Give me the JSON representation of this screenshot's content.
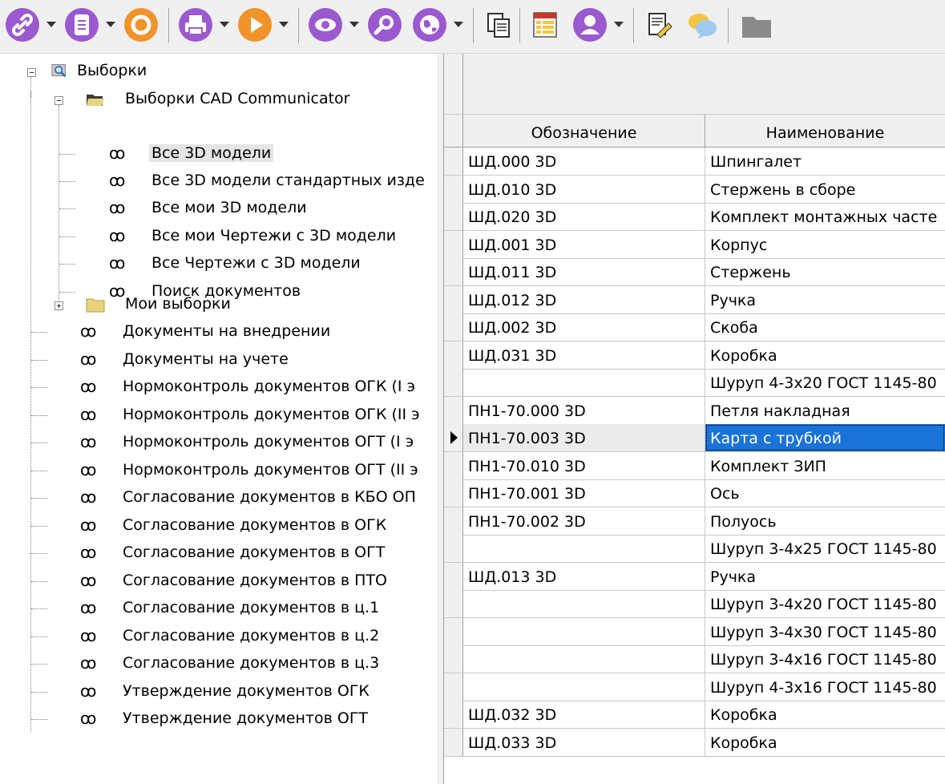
{
  "toolbar": {
    "buttons": [
      {
        "icon": "link-icon",
        "color": "#9b59d0"
      },
      {
        "icon": "document-icon",
        "color": "#9b59d0"
      },
      {
        "icon": "refresh-icon",
        "color": "#f0932b"
      },
      {
        "icon": "print-icon",
        "color": "#9b59d0"
      },
      {
        "icon": "play-icon",
        "color": "#f0932b"
      },
      {
        "icon": "eye-icon",
        "color": "#9b59d0"
      },
      {
        "icon": "search-icon",
        "color": "#9b59d0"
      },
      {
        "icon": "globe-icon",
        "color": "#9b59d0"
      },
      {
        "icon": "copy-icon",
        "color": "#555555"
      },
      {
        "icon": "report-icon",
        "color": "#c0392b"
      },
      {
        "icon": "user-icon",
        "color": "#9b59d0"
      },
      {
        "icon": "edit-document-icon",
        "color": "#555555"
      },
      {
        "icon": "comment-icon",
        "color": "#f5c542"
      },
      {
        "icon": "folder-icon",
        "color": "#888888"
      }
    ]
  },
  "tree": {
    "root": "Выборки",
    "cad_folder": "Выборки CAD Communicator",
    "cad_items": [
      "Все 3D модели",
      "Все 3D модели стандартных изде",
      "Все мои 3D модели",
      "Все мои Чертежи с 3D модели",
      "Все Чертежи с 3D модели",
      "Поиск документов"
    ],
    "my_folder": "Мои выборки",
    "items": [
      "Документы на внедрении",
      "Документы на учете",
      "Нормоконтроль документов ОГК (I э",
      "Нормоконтроль документов ОГК (II э",
      "Нормоконтроль документов ОГТ (I э",
      "Нормоконтроль документов ОГТ (II э",
      "Согласование документов в КБО ОП",
      "Согласование документов в ОГК",
      "Согласование документов в ОГТ",
      "Согласование документов в ПТО",
      "Согласование документов в ц.1",
      "Согласование документов в ц.2",
      "Согласование документов в ц.3",
      "Утверждение документов ОГК",
      "Утверждение документов ОГТ"
    ]
  },
  "grid": {
    "columns": [
      "Обозначение",
      "Наименование"
    ],
    "rows": [
      [
        "ШД.000 3D",
        "Шпингалет"
      ],
      [
        "ШД.010 3D",
        "Стержень в сборе"
      ],
      [
        "ШД.020 3D",
        "Комплект монтажных часте"
      ],
      [
        "ШД.001 3D",
        "Корпус"
      ],
      [
        "ШД.011 3D",
        "Стержень"
      ],
      [
        "ШД.012 3D",
        "Ручка"
      ],
      [
        "ШД.002 3D",
        "Скоба"
      ],
      [
        "ШД.031 3D",
        "Коробка"
      ],
      [
        "",
        "Шуруп 4-3x20 ГОСТ 1145-80"
      ],
      [
        "ПН1-70.000 3D",
        "Петля накладная"
      ],
      [
        "ПН1-70.003 3D",
        "Карта с трубкой"
      ],
      [
        "ПН1-70.010 3D",
        "Комплект ЗИП"
      ],
      [
        "ПН1-70.001 3D",
        "Ось"
      ],
      [
        "ПН1-70.002 3D",
        "Полуось"
      ],
      [
        "",
        "Шуруп 3-4x25 ГОСТ 1145-80"
      ],
      [
        "ШД.013 3D",
        "Ручка"
      ],
      [
        "",
        "Шуруп 3-4x20 ГОСТ 1145-80"
      ],
      [
        "",
        "Шуруп 3-4x30 ГОСТ 1145-80"
      ],
      [
        "",
        "Шуруп 3-4x16 ГОСТ 1145-80"
      ],
      [
        "",
        "Шуруп 4-3x16 ГОСТ 1145-80"
      ],
      [
        "ШД.032 3D",
        "Коробка"
      ],
      [
        "ШД.033 3D",
        "Коробка"
      ]
    ],
    "current_row": 10
  }
}
